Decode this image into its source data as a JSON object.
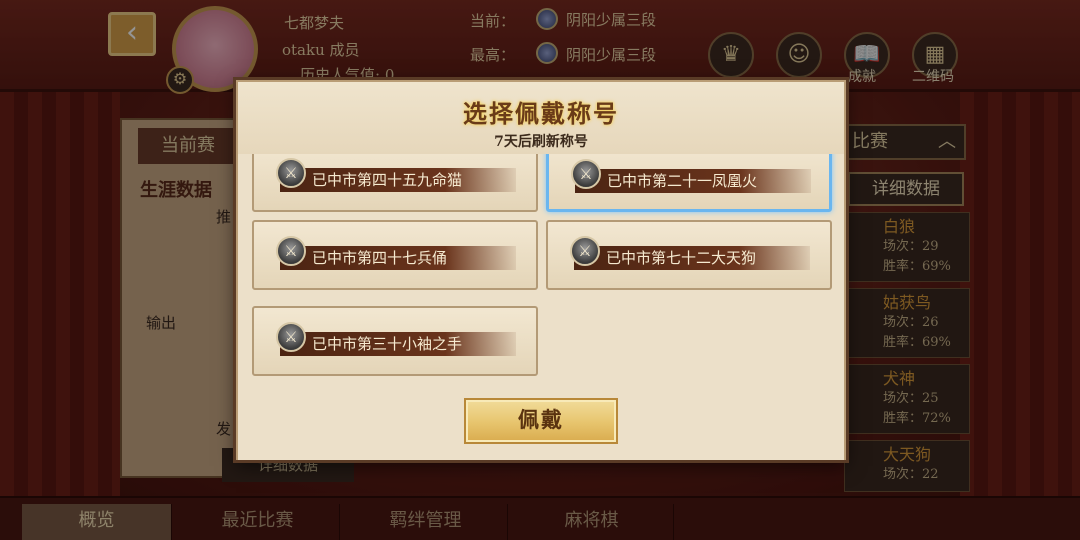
{
  "background": {
    "player_name": "七都梦夫",
    "guild": "otaku 成员",
    "popularity": "历史人气值: 0",
    "current_label": "当前：",
    "current_rank": "阴阳少属三段",
    "best_label": "最高：",
    "best_rank": "阴阳少属三段",
    "top_icons": [
      {
        "icon": "crown-icon",
        "glyph": "♛"
      },
      {
        "icon": "person-icon",
        "glyph": "☺"
      },
      {
        "icon": "book-icon",
        "glyph": "📖",
        "label": "成就"
      },
      {
        "icon": "qrcode-icon",
        "glyph": "▦",
        "label": "二维码"
      }
    ],
    "left_panel": {
      "tab": "当前赛",
      "career": "生涯数据",
      "push": "推",
      "output": "输出",
      "fa": "发",
      "detail_button": "详细数据"
    },
    "right_panel": {
      "tab": "比赛",
      "detail_button": "详细数据",
      "heroes": [
        {
          "name": "白狼",
          "matches": "场次：29",
          "winrate": "胜率：69%"
        },
        {
          "name": "姑获鸟",
          "matches": "场次：26",
          "winrate": "胜率：69%"
        },
        {
          "name": "犬神",
          "matches": "场次：25",
          "winrate": "胜率：72%"
        },
        {
          "name": "大天狗",
          "matches": "场次：22",
          "winrate": ""
        }
      ]
    },
    "bottom_nav": [
      "概览",
      "最近比赛",
      "羁绊管理",
      "麻将棋"
    ],
    "bottom_nav_active": 0
  },
  "modal": {
    "title": "选择佩戴称号",
    "subtitle": "7天后刷新称号",
    "options": [
      {
        "label": "已中市第四十五九命猫",
        "selected": false
      },
      {
        "label": "已中市第二十一凤凰火",
        "selected": true
      },
      {
        "label": "已中市第四十七兵俑",
        "selected": false
      },
      {
        "label": "已中市第七十二大天狗",
        "selected": false
      },
      {
        "label": "已中市第三十小袖之手",
        "selected": false
      }
    ],
    "wear_button": "佩戴"
  },
  "colors": {
    "modal_bg": "#ece0c9",
    "ribbon": "#4b2412",
    "selected_border": "#6ab6ef",
    "button_gold": "#e7c46d"
  }
}
